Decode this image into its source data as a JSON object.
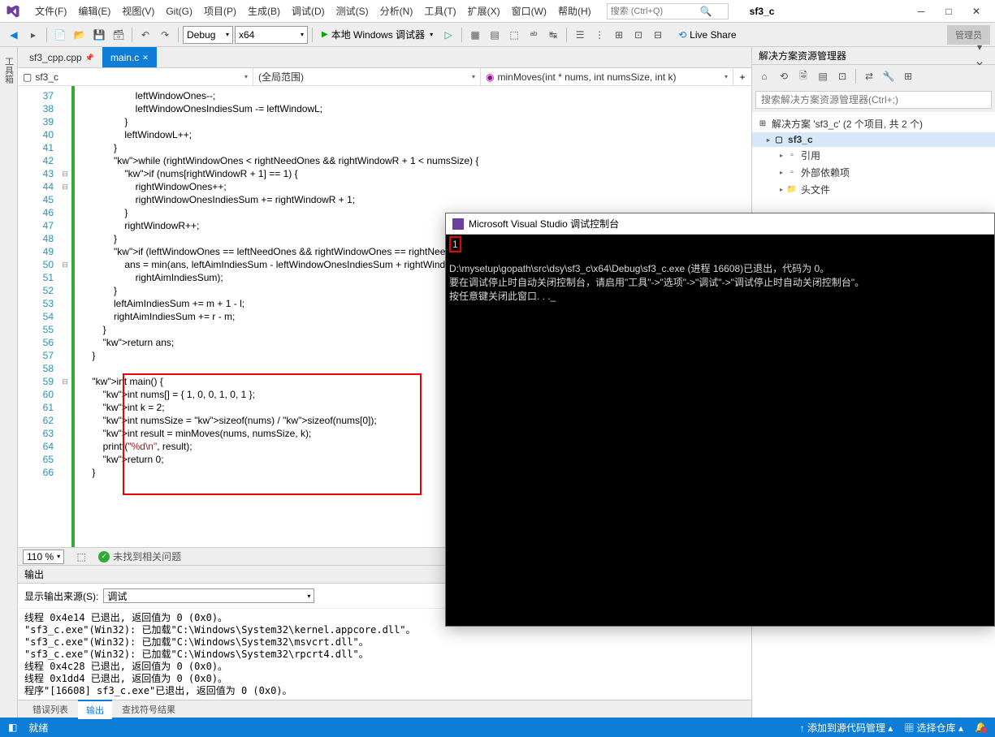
{
  "menu": {
    "items": [
      "文件(F)",
      "编辑(E)",
      "视图(V)",
      "Git(G)",
      "项目(P)",
      "生成(B)",
      "调试(D)",
      "测试(S)",
      "分析(N)",
      "工具(T)",
      "扩展(X)",
      "窗口(W)",
      "帮助(H)"
    ]
  },
  "search": {
    "placeholder": "搜索 (Ctrl+Q)"
  },
  "project_label": "sf3_c",
  "admin_label": "管理员",
  "toolbar": {
    "config": "Debug",
    "platform": "x64",
    "run": "本地 Windows 调试器",
    "live_share": "Live Share"
  },
  "tabs": [
    {
      "label": "sf3_cpp.cpp",
      "active": false,
      "pinned": true
    },
    {
      "label": "main.c",
      "active": true,
      "close": true
    }
  ],
  "nav": {
    "project": "sf3_c",
    "scope": "(全局范围)",
    "func": "minMoves(int * nums, int numsSize, int k)"
  },
  "left_tab": "工具箱",
  "gutter": {
    "start": 37,
    "end": 66
  },
  "code_lines": [
    "                    leftWindowOnes--;",
    "                    leftWindowOnesIndiesSum -= leftWindowL;",
    "                }",
    "                leftWindowL++;",
    "            }",
    "            while (rightWindowOnes < rightNeedOnes && rightWindowR + 1 < numsSize) {",
    "                if (nums[rightWindowR + 1] == 1) {",
    "                    rightWindowOnes++;",
    "                    rightWindowOnesIndiesSum += rightWindowR + 1;",
    "                }",
    "                rightWindowR++;",
    "            }",
    "            if (leftWindowOnes == leftNeedOnes && rightWindowOnes == rightNeedOnes) {",
    "                ans = min(ans, leftAimIndiesSum - leftWindowOnesIndiesSum + rightWindowOnesIndiesSum -",
    "                    rightAimIndiesSum);",
    "            }",
    "            leftAimIndiesSum += m + 1 - l;",
    "            rightAimIndiesSum += r - m;",
    "        }",
    "        return ans;",
    "    }",
    "",
    "    int main() {",
    "        int nums[] = { 1, 0, 0, 1, 0, 1 };",
    "        int k = 2;",
    "        int numsSize = sizeof(nums) / sizeof(nums[0]);",
    "        int result = minMoves(nums, numsSize, k);",
    "        printf(\"%d\\n\", result);",
    "        return 0;",
    "    }"
  ],
  "zoom": "110 %",
  "issue_text": "未找到相关问题",
  "output": {
    "title": "输出",
    "source_label": "显示输出来源(S):",
    "source_value": "调试",
    "lines": [
      "线程 0x4e14 已退出, 返回值为 0 (0x0)。",
      "\"sf3_c.exe\"(Win32): 已加载\"C:\\Windows\\System32\\kernel.appcore.dll\"。",
      "\"sf3_c.exe\"(Win32): 已加载\"C:\\Windows\\System32\\msvcrt.dll\"。",
      "\"sf3_c.exe\"(Win32): 已加载\"C:\\Windows\\System32\\rpcrt4.dll\"。",
      "线程 0x4c28 已退出, 返回值为 0 (0x0)。",
      "线程 0x1dd4 已退出, 返回值为 0 (0x0)。",
      "程序\"[16608] sf3_c.exe\"已退出, 返回值为 0 (0x0)。"
    ],
    "tabs": [
      "错误列表",
      "输出",
      "查找符号结果"
    ]
  },
  "solution": {
    "title": "解决方案资源管理器",
    "search_placeholder": "搜索解决方案资源管理器(Ctrl+;)",
    "root": "解决方案 'sf3_c' (2 个项目, 共 2 个)",
    "items": [
      {
        "label": "sf3_c",
        "bold": true,
        "indent": 1,
        "icon": "▢"
      },
      {
        "label": "引用",
        "indent": 2,
        "icon": "▫"
      },
      {
        "label": "外部依赖项",
        "indent": 2,
        "icon": "▫"
      },
      {
        "label": "头文件",
        "indent": 2,
        "icon": "📁"
      }
    ]
  },
  "console": {
    "title": "Microsoft Visual Studio 调试控制台",
    "output": "1",
    "body": "D:\\mysetup\\gopath\\src\\dsy\\sf3_c\\x64\\Debug\\sf3_c.exe (进程 16608)已退出，代码为 0。\n要在调试停止时自动关闭控制台，请启用\"工具\"->\"选项\"->\"调试\"->\"调试停止时自动关闭控制台\"。\n按任意键关闭此窗口. . ._"
  },
  "status": {
    "ready": "就绪",
    "src": "添加到源代码管理",
    "repo": "选择仓库"
  }
}
